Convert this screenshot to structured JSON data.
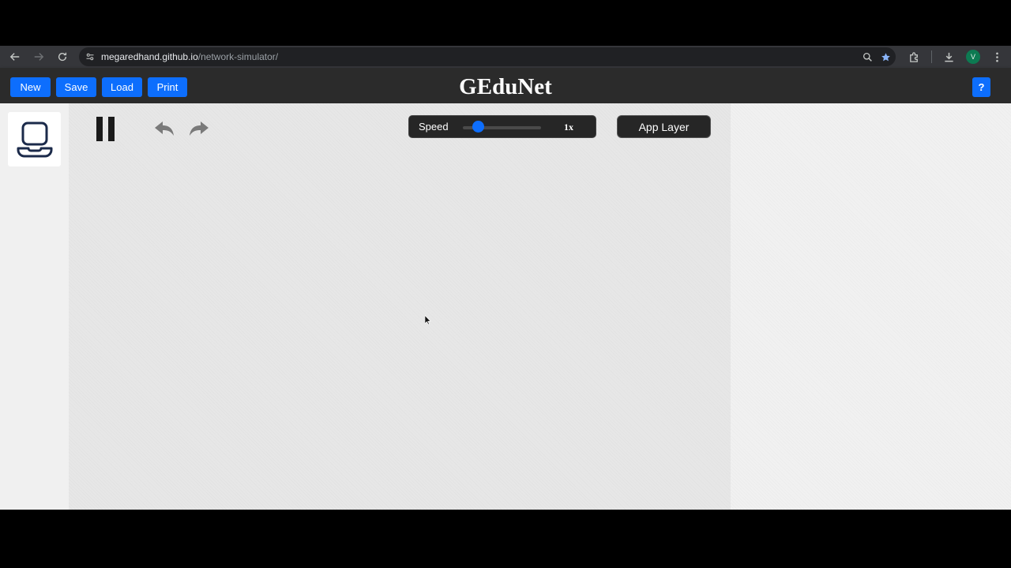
{
  "browser": {
    "url_host": "megaredhand.github.io",
    "url_path": "/network-simulator/",
    "profile_initial": "V"
  },
  "header": {
    "title": "GEduNet",
    "buttons": {
      "new": "New",
      "save": "Save",
      "load": "Load",
      "print": "Print",
      "help": "?"
    }
  },
  "sidebar": {
    "items": [
      {
        "icon": "laptop-icon"
      }
    ]
  },
  "canvas_toolbar": {
    "play_state": "pause-icon",
    "speed_label": "Speed",
    "speed_value": "1x",
    "speed_slider_fraction": 0.2,
    "layer_button": "App Layer"
  },
  "colors": {
    "accent": "#0d6efd",
    "header_bg": "#2b2b2b",
    "device_stroke": "#1b2a4a"
  }
}
